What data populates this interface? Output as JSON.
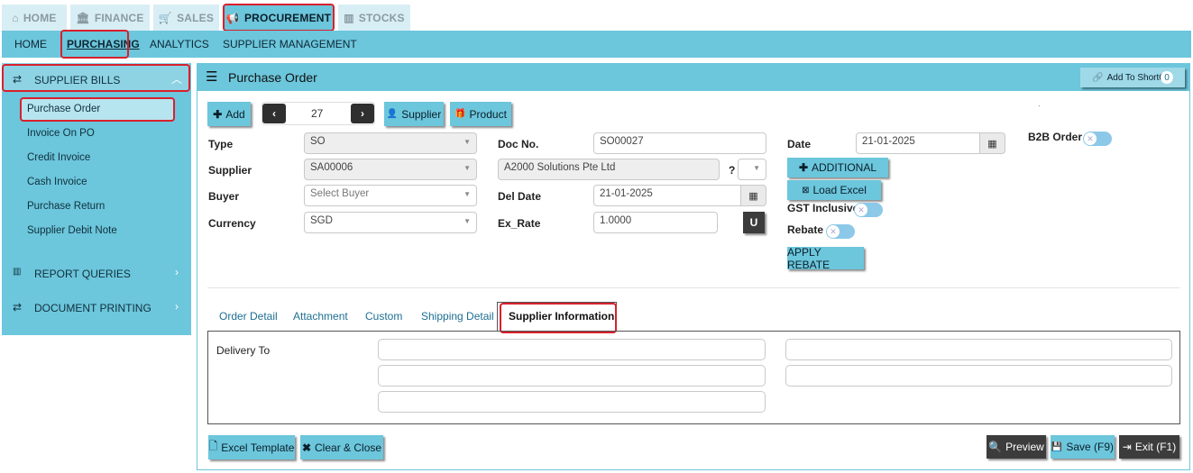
{
  "modules": [
    {
      "label": "HOME",
      "icon": "home-icon"
    },
    {
      "label": "FINANCE",
      "icon": "bank-icon"
    },
    {
      "label": "SALES",
      "icon": "cart-icon"
    },
    {
      "label": "PROCUREMENT",
      "icon": "megaphone-icon"
    },
    {
      "label": "STOCKS",
      "icon": "bar-chart-icon"
    }
  ],
  "subnav": [
    "HOME",
    "PURCHASING",
    "ANALYTICS",
    "SUPPLIER MANAGEMENT"
  ],
  "sidebar": {
    "section1": "SUPPLIER BILLS",
    "items": [
      "Purchase Order",
      "Invoice On PO",
      "Credit Invoice",
      "Cash Invoice",
      "Purchase Return",
      "Supplier Debit Note"
    ],
    "section2": "REPORT QUERIES",
    "section3": "DOCUMENT PRINTING"
  },
  "page": {
    "title": "Purchase Order",
    "shortcut_label": "Add To ShortCut",
    "shortcut_count": "0",
    "dot": "."
  },
  "toolbar": {
    "add": "Add",
    "record_no": "27",
    "supplier": "Supplier",
    "product": "Product"
  },
  "form": {
    "type_label": "Type",
    "type_value": "SO",
    "supplier_label": "Supplier",
    "supplier_value": "SA00006",
    "supplier_name": "A2000 Solutions Pte Ltd",
    "supplier_q": "?",
    "buyer_label": "Buyer",
    "buyer_placeholder": "Select Buyer",
    "currency_label": "Currency",
    "currency_value": "SGD",
    "docno_label": "Doc No.",
    "docno_value": "SO00027",
    "deldate_label": "Del Date",
    "deldate_value": "21-01-2025",
    "exrate_label": "Ex_Rate",
    "exrate_value": "1.0000",
    "u_button": "U",
    "date_label": "Date",
    "date_value": "21-01-2025",
    "additional": "ADDITIONAL",
    "load_excel": "Load Excel",
    "gst_label": "GST Inclusive",
    "rebate_label": "Rebate",
    "apply_rebate": "APPLY REBATE",
    "b2b_label": "B2B Order"
  },
  "tabs": [
    "Order Detail",
    "Attachment",
    "Custom",
    "Shipping Detail",
    "Supplier Information"
  ],
  "active_tab": "Supplier Information",
  "tab_content": {
    "delivery_to": "Delivery To"
  },
  "footer": {
    "excel_template": "Excel Template",
    "clear_close": "Clear & Close",
    "preview": "Preview",
    "save": "Save (F9)",
    "exit": "Exit (F1)"
  },
  "colors": {
    "accent": "#6cc6dc",
    "highlight": "#d9202c",
    "dark_button": "#3c3c3c"
  }
}
